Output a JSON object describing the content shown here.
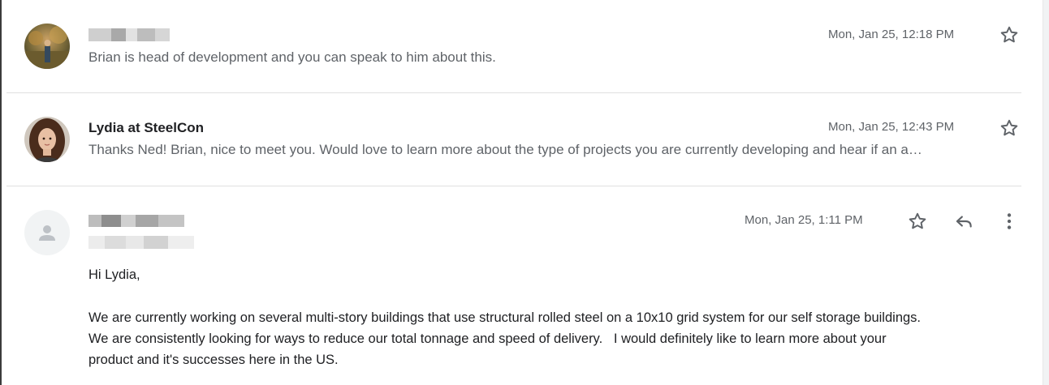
{
  "emails": [
    {
      "sender": "",
      "sender_redacted": true,
      "snippet": "Brian is head of development and you can speak to him about this.",
      "date": "Mon, Jan 25, 12:18 PM"
    },
    {
      "sender": "Lydia at SteelCon",
      "snippet": "Thanks Ned! Brian, nice to meet you. Would love to learn more about the type of projects you are currently developing and hear if an a…",
      "date": "Mon, Jan 25, 12:43 PM"
    },
    {
      "sender": "",
      "sender_redacted": true,
      "date": "Mon, Jan 25, 1:11 PM",
      "body": {
        "greeting": "Hi Lydia,",
        "lines": [
          "We are currently working on several multi-story buildings that use structural rolled steel on a 10x10 grid system for our self storage buildings.",
          "We are consistently looking for ways to reduce our total tonnage and speed of delivery.   I would definitely like to learn more about your",
          "product and it's successes here in the US."
        ]
      }
    }
  ],
  "icons": {
    "star": "star-icon",
    "reply": "reply-icon",
    "more": "more-vert-icon",
    "default_avatar": "person-icon"
  },
  "colors": {
    "text_primary": "#202124",
    "text_secondary": "#5f6368",
    "divider": "#e0e0e0"
  }
}
